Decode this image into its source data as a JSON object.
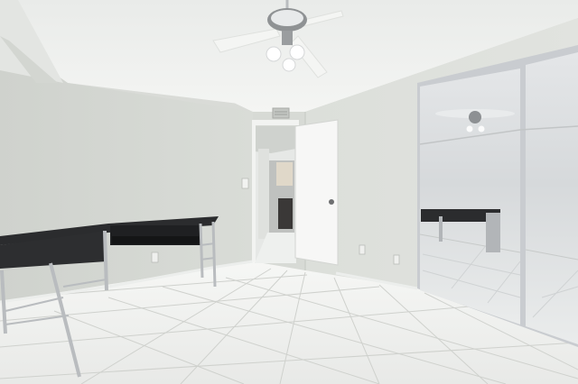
{
  "scene": {
    "kind": "interior-photo",
    "room": "empty bedroom",
    "features": [
      "ceiling-fan",
      "mirrored-closet-doors",
      "glass-top-desk",
      "tile-floor",
      "open-door",
      "air-vent"
    ]
  },
  "colors": {
    "ceiling": "#eef0ee",
    "wall_left": "#d3d6d1",
    "wall_back": "#dcdfda",
    "wall_right": "#d8dbd6",
    "floor": "#f1f2f0",
    "grout": "#cfd1cd",
    "desk_top": "#2b2c2e",
    "chrome": "#b9bcbf",
    "door": "#f7f7f6",
    "mirror_frame": "#c9ccd0"
  }
}
